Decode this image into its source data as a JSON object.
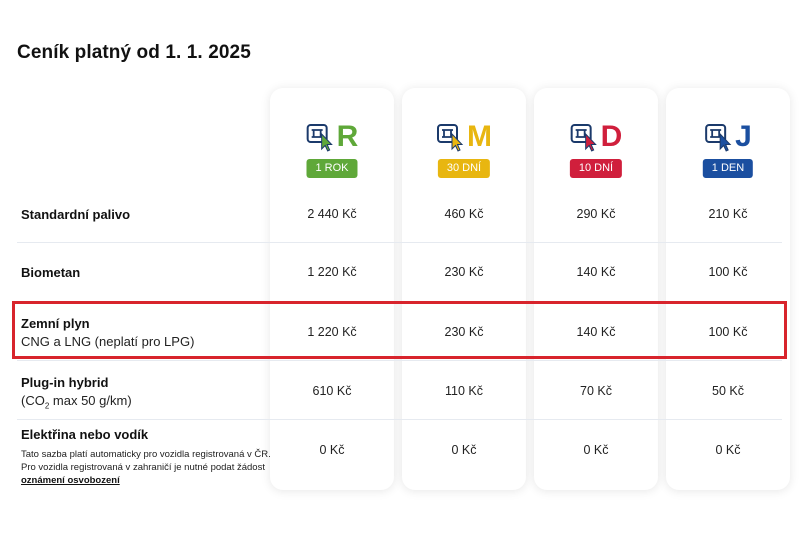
{
  "title": "Ceník platný od 1. 1. 2025",
  "columns": [
    {
      "letter": "R",
      "badge": "1 ROK",
      "color": "#5fa839",
      "icon": "e-vignette-icon"
    },
    {
      "letter": "M",
      "badge": "30 DNÍ",
      "color": "#e8b610",
      "icon": "e-vignette-icon"
    },
    {
      "letter": "D",
      "badge": "10 DNÍ",
      "color": "#d01f3c",
      "icon": "e-vignette-icon"
    },
    {
      "letter": "J",
      "badge": "1 DEN",
      "color": "#1b4fa0",
      "icon": "e-vignette-icon"
    }
  ],
  "rows": [
    {
      "label": "Standardní palivo",
      "prices": [
        "2 440 Kč",
        "460 Kč",
        "290 Kč",
        "210 Kč"
      ]
    },
    {
      "label": "Biometan",
      "prices": [
        "1 220 Kč",
        "230 Kč",
        "140 Kč",
        "100 Kč"
      ]
    },
    {
      "label": "Zemní plyn",
      "sub": "CNG a LNG (neplatí pro LPG)",
      "prices": [
        "1 220 Kč",
        "230 Kč",
        "140 Kč",
        "100 Kč"
      ]
    },
    {
      "label": "Plug-in hybrid",
      "sub_pre": "(CO",
      "sub_subscript": "2",
      "sub_post": " max 50 g/km)",
      "prices": [
        "610 Kč",
        "110 Kč",
        "70 Kč",
        "50 Kč"
      ]
    },
    {
      "label": "Elektřina nebo vodík",
      "note_line1": "Tato sazba platí automaticky pro vozidla registrovaná v ČR.",
      "note_line2": "Pro vozidla registrovaná v zahraničí je nutné podat žádost",
      "note_link": "oznámení osvobození",
      "prices": [
        "0 Kč",
        "0 Kč",
        "0 Kč",
        "0 Kč"
      ]
    }
  ]
}
